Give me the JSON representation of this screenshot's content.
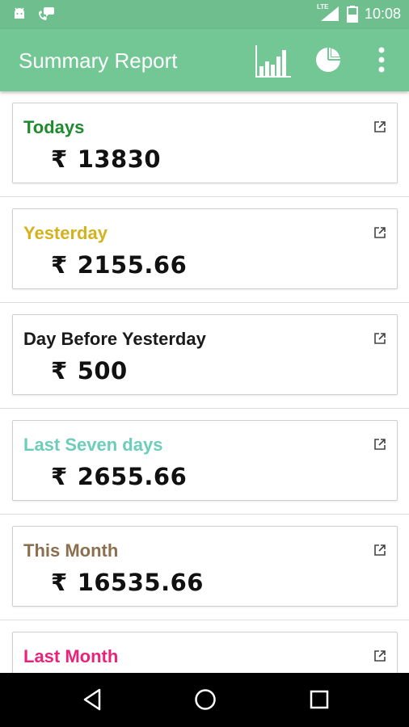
{
  "status_bar": {
    "time": "10:08",
    "network": "LTE",
    "icons": [
      "android-icon",
      "phone-icon",
      "signal-icon",
      "battery-icon"
    ]
  },
  "app_bar": {
    "title": "Summary Report",
    "actions": [
      "bar-chart-icon",
      "pie-chart-icon",
      "overflow-menu-icon"
    ],
    "color": "#72c795"
  },
  "summary": {
    "currency": "₹",
    "cards": [
      {
        "label": "Todays",
        "amount": "13830",
        "color": "#1f8a2e"
      },
      {
        "label": "Yesterday",
        "amount": "2155.66",
        "color": "#d4b21e"
      },
      {
        "label": "Day Before Yesterday",
        "amount": "500",
        "color": "#1a1a1a"
      },
      {
        "label": "Last Seven days",
        "amount": "2655.66",
        "color": "#6ccdbb"
      },
      {
        "label": "This Month",
        "amount": "16535.66",
        "color": "#8b6f4e"
      },
      {
        "label": "Last Month",
        "amount": "",
        "color": "#e8237a"
      }
    ]
  },
  "nav_bar": {
    "buttons": [
      "back-icon",
      "home-icon",
      "recents-icon"
    ]
  }
}
